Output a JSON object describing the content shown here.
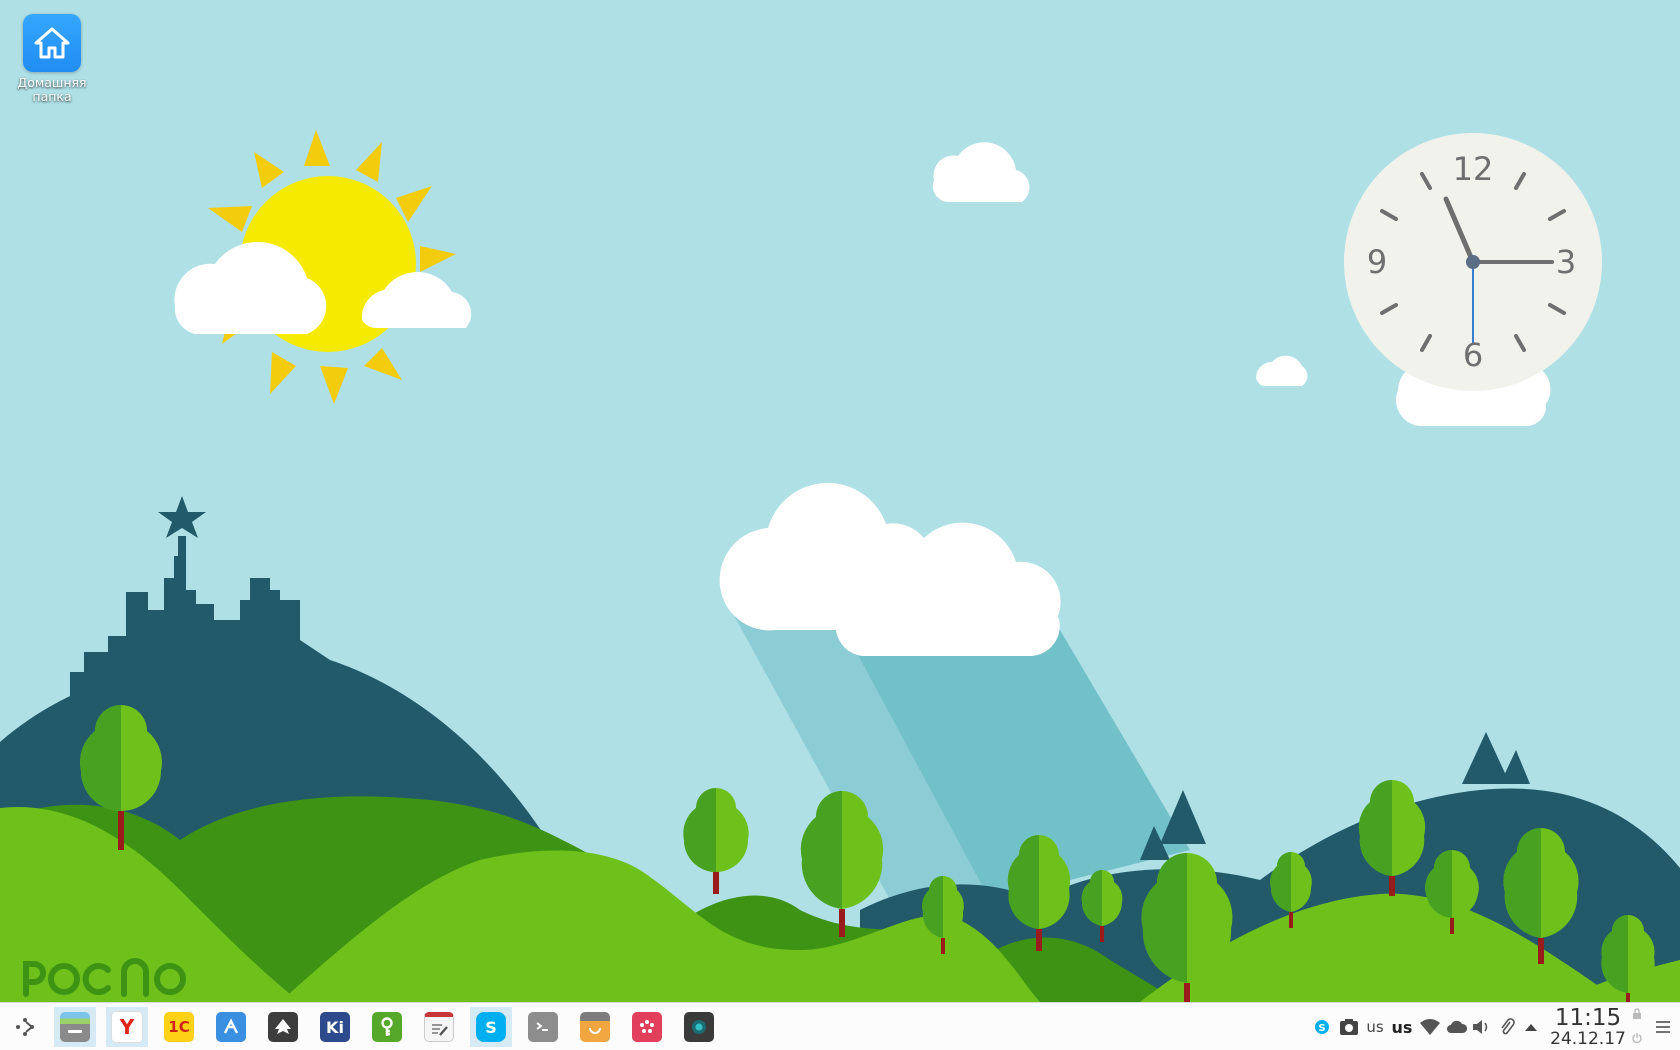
{
  "desktop": {
    "home_folder_label": "Домашняя папка",
    "logo_text": "РОСНО"
  },
  "clock_widget": {
    "numerals": [
      "12",
      "3",
      "6",
      "9"
    ],
    "time_shown": "11:15"
  },
  "taskbar": {
    "apps": [
      {
        "name": "file-manager",
        "icon": "folder-icon"
      },
      {
        "name": "yandex-browser",
        "icon": "yandex-icon",
        "text": "Y"
      },
      {
        "name": "1c",
        "icon": "1c-icon",
        "text": "1С"
      },
      {
        "name": "kdevelop",
        "icon": "code-icon"
      },
      {
        "name": "inkscape",
        "icon": "inkscape-icon"
      },
      {
        "name": "kicad",
        "icon": "kicad-icon",
        "text": "Ki"
      },
      {
        "name": "keepass",
        "icon": "key-icon"
      },
      {
        "name": "text-editor",
        "icon": "notes-icon"
      },
      {
        "name": "skype",
        "icon": "skype-icon",
        "text": "S"
      },
      {
        "name": "terminal",
        "icon": "terminal-icon"
      },
      {
        "name": "software-center",
        "icon": "store-icon"
      },
      {
        "name": "music-player",
        "icon": "music-icon"
      },
      {
        "name": "camera",
        "icon": "camera-icon"
      }
    ],
    "tray": {
      "layout_small": "us",
      "layout_bold": "us"
    },
    "time": "11:15",
    "date": "24.12.17"
  },
  "colors": {
    "sky": "#aee0e6",
    "sun": "#f5ea00",
    "sun_rays": "#f4cc0e",
    "hill_dark": "#225a6a",
    "grass_light": "#6ec11b",
    "grass_dark": "#3e9314",
    "tree_light": "#6ec11b",
    "tree_dark": "#48a120",
    "taskbar": "#fcfcfc",
    "accent": "#3daee9"
  }
}
